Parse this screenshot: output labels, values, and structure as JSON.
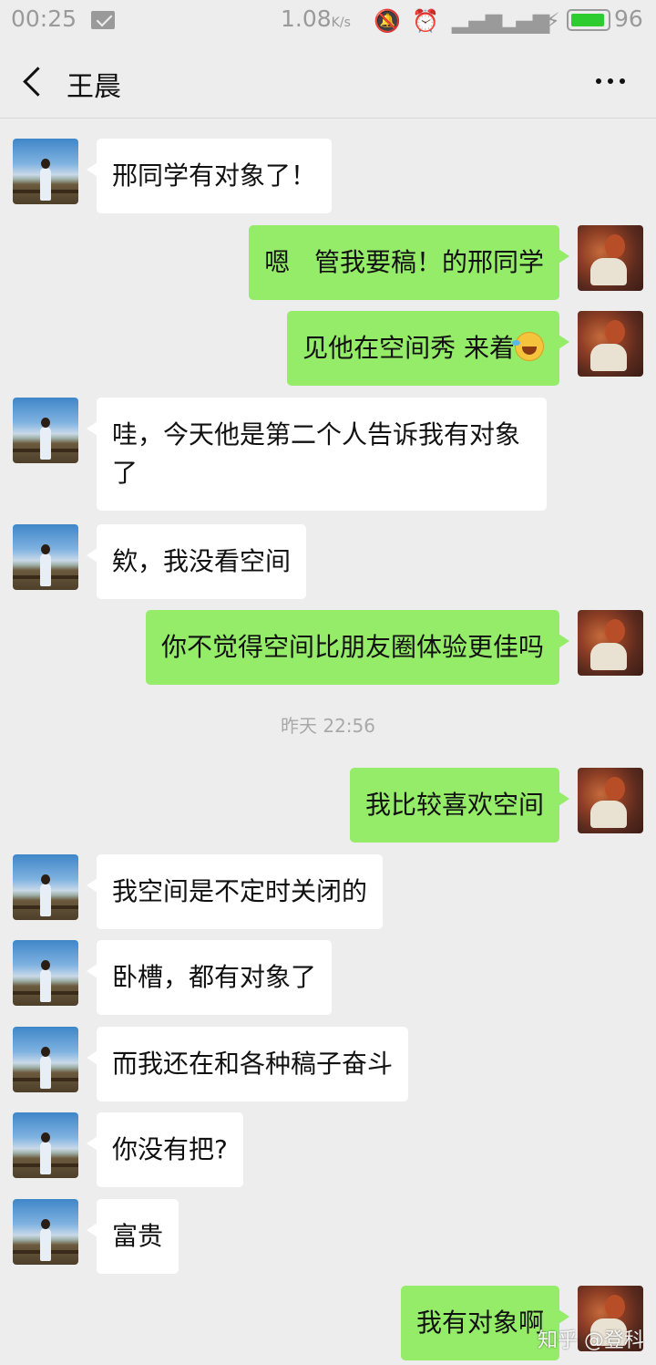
{
  "status_bar": {
    "time": "00:25",
    "network_speed": "1.08",
    "network_speed_unit": "K/s",
    "battery_percent": "96",
    "battery_level": 0.96,
    "icons": [
      "mail-icon",
      "mute-icon",
      "alarm-icon",
      "signal-icon",
      "signal-icon",
      "charging-icon",
      "battery-icon"
    ],
    "battery_color": "#2ecc2e"
  },
  "header": {
    "title": "王晨",
    "back_icon": "chevron-left-icon",
    "more_icon": "more-dots-icon"
  },
  "colors": {
    "background": "#ededed",
    "sent_bubble": "#95ec69",
    "received_bubble": "#ffffff"
  },
  "messages": [
    {
      "side": "left",
      "text": "邢同学有对象了！"
    },
    {
      "side": "right",
      "text": "嗯   管我要稿！的邢同学"
    },
    {
      "side": "right",
      "text": "见他在空间秀 来着",
      "emoji": "laughing-tears-emoji"
    },
    {
      "side": "left",
      "text": "哇，今天他是第二个人告诉我有对象了"
    },
    {
      "side": "left",
      "text": "欸，我没看空间"
    },
    {
      "side": "right",
      "text": "你不觉得空间比朋友圈体验更佳吗"
    },
    {
      "side": "right",
      "text": "我比较喜欢空间"
    },
    {
      "side": "left",
      "text": "我空间是不定时关闭的"
    },
    {
      "side": "left",
      "text": "卧槽，都有对象了"
    },
    {
      "side": "left",
      "text": "而我还在和各种稿子奋斗"
    },
    {
      "side": "left",
      "text": "你没有把?"
    },
    {
      "side": "left",
      "text": "富贵"
    },
    {
      "side": "right",
      "text": "我有对象啊"
    }
  ],
  "timestamp": "昨天 22:56",
  "watermark": "知乎 @登科"
}
